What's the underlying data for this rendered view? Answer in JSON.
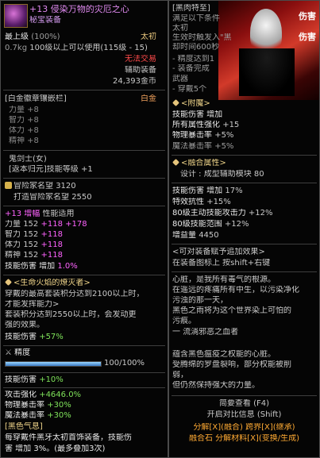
{
  "item": {
    "name_line": "+13 侵染万物的灾厄之心",
    "subtitle": "秘宝装备",
    "max_level": "最上级",
    "max_level_pct": "(100%)",
    "tier": "太初",
    "weight": "0.7kg",
    "level_req": "100级以上可以使用(115级 - 15)",
    "trade": "无法交易",
    "equip_type": "辅助装备",
    "price": "24,393金币",
    "emblem_header": "[白金徽章镶嵌栏]",
    "emblem_type": "白金",
    "emblem_stats": [
      "力量 +8",
      "智力 +8",
      "体力 +8",
      "精神 +8"
    ],
    "class_line": "鬼剑士(女)",
    "return_line": "[返本归元]技能等级 +1",
    "adv_rep_label": "冒险家名望",
    "adv_rep_value": "3120",
    "forge_rep_label": "打造冒险家名望",
    "forge_rep_value": "2550",
    "amp_line_a": "+13",
    "amp_line_b": "增幅",
    "amp_line_c": "性能适用",
    "stats": [
      {
        "name": "力量",
        "base": "152",
        "b1": "+118",
        "b2": "+178"
      },
      {
        "name": "智力",
        "base": "152",
        "b1": "+118",
        "b2": ""
      },
      {
        "name": "体力",
        "base": "152",
        "b1": "+118",
        "b2": ""
      },
      {
        "name": "精神",
        "base": "152",
        "b1": "+118",
        "b2": ""
      }
    ],
    "skill_dmg_label": "技能伤害 增加",
    "skill_dmg_value": "1.0%",
    "life_title": "<生命火焰的燎灭者>",
    "life_desc": [
      "穿戴的最高套装积分达到2100以上时，",
      "才能发挥能力>",
      "套装积分达到2550以上时，会发动更",
      "强的效果。"
    ],
    "life_skill": "技能伤害",
    "life_skill_val": "+57%",
    "refine_label": "精度",
    "refine_progress": "100/100%",
    "refine_fill_pct": 100,
    "skill_dmg2_label": "技能伤害",
    "skill_dmg2_value": "+10%",
    "atk_label": "攻击强化",
    "atk_value": "+4646.0%",
    "crit_label": "物理暴击率",
    "crit_value": "+30%",
    "mcrit_label": "魔法暴击率",
    "mcrit_value": "+30%",
    "dark_title": "[黑色气息]",
    "dark_desc": [
      "每穿戴件黑牙太初首饰装备，技能伤",
      "害 增加 3%。(最多叠加3次)"
    ]
  },
  "right": {
    "header": "[黑肉特至]",
    "desc": [
      "满足以下条件",
      "太初",
      "生效时触发入\"黑",
      "却时间600秒",
      "- 精度达到1",
      "- 装备完成",
      "武器",
      "- 穿戴5个"
    ],
    "enchant_title": "<附魔>",
    "enchant_stats": [
      {
        "label": "技能伤害 增加",
        "val": ""
      },
      {
        "label": "所有属性强化",
        "val": "+15"
      },
      {
        "label": "物理暴击率",
        "val": "+5%"
      },
      {
        "label": "魔法暴击率",
        "val": "+5%"
      }
    ],
    "fusion_title": "<融合属性>",
    "fusion_design": "设计 : 成型辅助模块",
    "fusion_design_val": "80",
    "fusion_stats": [
      {
        "label": "技能伤害 增加",
        "val": "17%"
      },
      {
        "label": "特效抗性",
        "val": "+15%"
      },
      {
        "label": "80级主动技能攻击力",
        "val": "+12%"
      },
      {
        "label": "80级技能范围",
        "val": "+12%"
      },
      {
        "label": "增益量",
        "val": "4450"
      }
    ],
    "upgrade_title": "<可对装备赋予追加效果>",
    "upgrade_hint": "在装备图标上 按shift+右键",
    "lore": [
      "心脏，是我所有毒气的根源。",
      "在遥远的疼痛所有中生，以污染净化",
      "污浊的那一天，",
      "黑色之雨将为这个世界染上可怕的",
      "污痕。",
      "一  流淌邪恶之血者",
      "",
      "蕴含黑色瘟疫之权能的心脏。",
      "受腾绵的罗盘裂响，部分权能被削",
      "弱，",
      "但仍然保持强大的力量。"
    ],
    "brief_view": "简要查看 (F4)",
    "compare_info": "开启对比信息 (Shift)",
    "actions": [
      "分解[X](融合)",
      "跨界[X](继承)",
      "融合石 分解材料[X](变换/生成)"
    ],
    "banner_caption_1": "伤害",
    "banner_caption_2": "伤害"
  },
  "colors": {
    "gold": "#e5c47b",
    "green": "#7fe35a",
    "purple": "#ff63ff",
    "red": "#ff4a4a",
    "orange": "#ffaa33"
  }
}
